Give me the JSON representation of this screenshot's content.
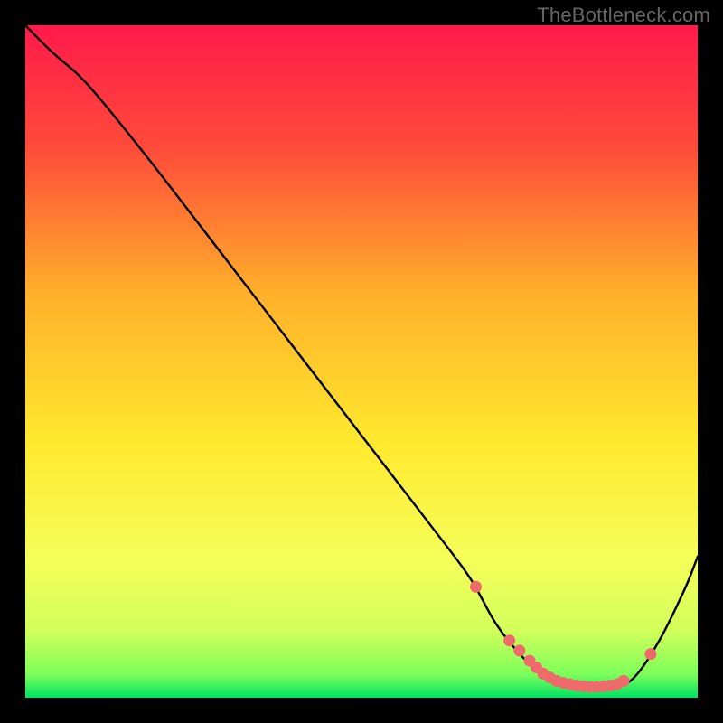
{
  "watermark": "TheBottleneck.com",
  "colors": {
    "background": "#000000",
    "curve": "#000000",
    "marker_fill": "#ef6a6a",
    "marker_stroke": "#ef6a6a",
    "gradient_top": "#ff1a4b",
    "gradient_mid_upper": "#ff8a2a",
    "gradient_mid": "#ffe92e",
    "gradient_mid_lower": "#f7ff66",
    "gradient_bottom": "#00e263"
  },
  "chart_data": {
    "type": "line",
    "title": "",
    "xlabel": "",
    "ylabel": "",
    "xlim": [
      0,
      100
    ],
    "ylim": [
      0,
      100
    ],
    "series": [
      {
        "name": "bottleneck-curve",
        "x": [
          0,
          4,
          8,
          12,
          20,
          30,
          40,
          50,
          60,
          66,
          70,
          74,
          78,
          82,
          86,
          90,
          94,
          98,
          100
        ],
        "y": [
          100,
          96,
          92.5,
          88,
          78,
          65,
          52,
          39,
          26,
          18,
          11,
          6,
          2.5,
          1.5,
          1.5,
          2.5,
          8,
          16,
          21
        ]
      }
    ],
    "markers": {
      "name": "highlight-dots",
      "x": [
        67,
        72,
        73.5,
        75,
        76,
        77,
        78,
        79,
        80,
        81,
        82,
        83,
        84,
        85,
        86,
        87,
        88,
        89,
        93
      ],
      "y": [
        16.5,
        8.5,
        7,
        5.5,
        4.5,
        3.6,
        3,
        2.5,
        2.2,
        2,
        1.8,
        1.7,
        1.6,
        1.6,
        1.7,
        1.8,
        2,
        2.5,
        6.5
      ]
    },
    "gradient_stops": [
      {
        "offset": 0.0,
        "color": "#ff1a4b"
      },
      {
        "offset": 0.18,
        "color": "#ff4a3a"
      },
      {
        "offset": 0.4,
        "color": "#ffb02a"
      },
      {
        "offset": 0.62,
        "color": "#ffe92e"
      },
      {
        "offset": 0.8,
        "color": "#f4ff5a"
      },
      {
        "offset": 0.9,
        "color": "#d2ff5a"
      },
      {
        "offset": 0.965,
        "color": "#7dff5a"
      },
      {
        "offset": 1.0,
        "color": "#00e263"
      }
    ]
  }
}
